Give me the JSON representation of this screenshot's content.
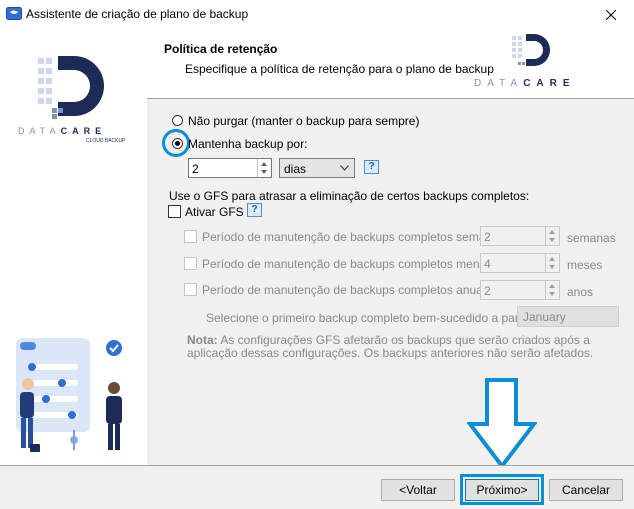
{
  "window": {
    "title": "Assistente de criação de plano de backup"
  },
  "header": {
    "title": "Política de retenção",
    "subtitle": "Especifique a política de retenção para o plano de backup"
  },
  "brand": {
    "text_data": "DATA",
    "text_care": "CARE",
    "tagline": "CLOUD BACKUP"
  },
  "retention": {
    "no_purge_label": "Não purgar (manter o backup para sempre)",
    "keep_label": "Mantenha backup por:",
    "keep_value": "2",
    "unit_selected": "dias",
    "gfs_intro": "Use o GFS para atrasar a eliminação de certos backups completos:",
    "gfs_enable_label": "Ativar GFS",
    "weekly": {
      "label": "Período de manutenção de backups completos semanais:",
      "value": "2",
      "unit": "semanas"
    },
    "monthly": {
      "label": "Período de manutenção de backups completos mensais:",
      "value": "4",
      "unit": "meses"
    },
    "yearly": {
      "label": "Período de manutenção de backups completos anuais:",
      "value": "2",
      "unit": "anos"
    },
    "first_backup_label": "Selecione o primeiro backup completo bem-sucedido a partir de:",
    "month_selected": "January",
    "note_bold": "Nota:",
    "note_text": "As configurações GFS afetarão os backups que serão criados após a aplicação dessas configurações. Os backups anteriores não serão afetados."
  },
  "help_glyph": "?",
  "footer": {
    "back_label": "<Voltar",
    "next_label": "Próximo>",
    "cancel_label": "Cancelar"
  },
  "colors": {
    "highlight": "#0a8fd6",
    "brand_blue": "#1d2b57",
    "accent_light": "#cfd8ea"
  }
}
